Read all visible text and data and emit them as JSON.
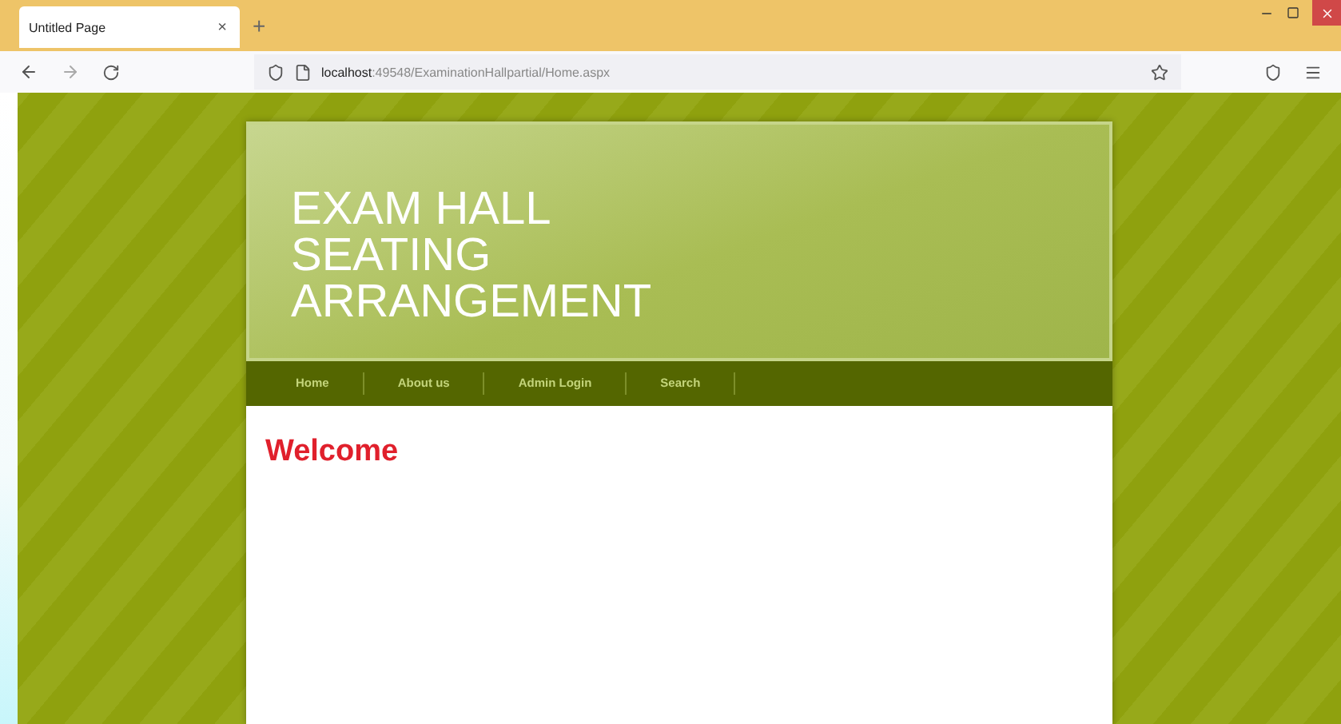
{
  "browser": {
    "tab": {
      "title": "Untitled Page",
      "close": "×"
    },
    "new_tab": "+",
    "address": {
      "host": "localhost",
      "path": ":49548/ExaminationHallpartial/Home.aspx"
    }
  },
  "site": {
    "title": "EXAM HALL SEATING ARRANGEMENT",
    "nav": [
      {
        "label": "Home"
      },
      {
        "label": "About us"
      },
      {
        "label": "Admin Login"
      },
      {
        "label": "Search"
      }
    ],
    "heading": "Welcome"
  }
}
